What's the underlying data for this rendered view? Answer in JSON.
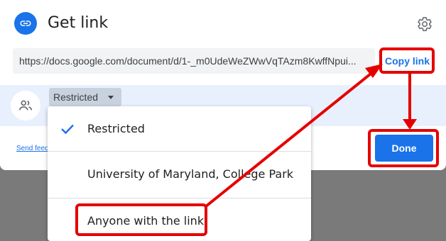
{
  "dialog": {
    "title": "Get link",
    "link_url": "https://docs.google.com/document/d/1-_m0UdeWeZWwVqTAzm8KwffNpui...",
    "copy_link_label": "Copy link",
    "access_selected": "Restricted",
    "send_feedback_label": "Send feedback",
    "done_label": "Done"
  },
  "access_menu": {
    "items": [
      {
        "label": "Restricted",
        "checked": true
      },
      {
        "label": "University of Maryland, College Park",
        "checked": false
      },
      {
        "label": "Anyone with the link",
        "checked": false
      }
    ]
  },
  "colors": {
    "accent": "#1a73e8",
    "annotation": "#e50000",
    "access_band": "#e8f0fe"
  },
  "icons": {
    "title": "link-icon",
    "settings": "gear-icon",
    "people": "people-icon",
    "dropdown": "caret-down-icon",
    "check": "check-icon"
  }
}
